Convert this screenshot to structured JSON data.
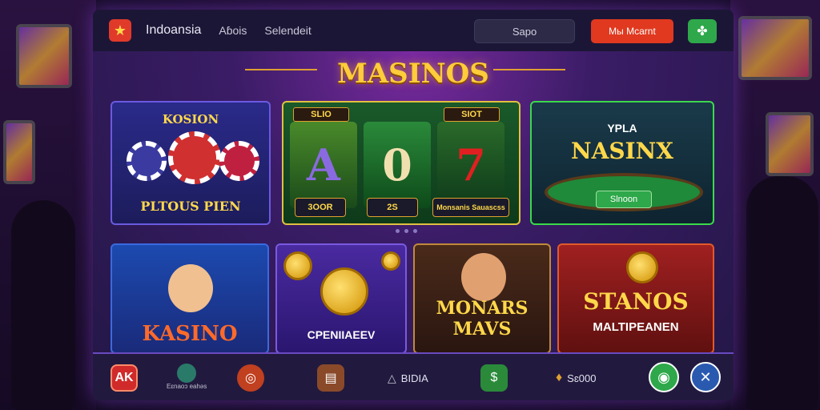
{
  "header": {
    "brand": "Indoansia",
    "nav": [
      "Aɓois",
      "Selendeit"
    ],
    "search_label": "Sapo",
    "cta_label": "Мы Mcarnt",
    "settings_icon": "clover-icon"
  },
  "section_title": "MASINOS",
  "cards_top": [
    {
      "top_label": "KOSION",
      "bottom_label": "PLTOUS PIEN"
    },
    {
      "reels": [
        {
          "tag": "SLIO",
          "symbol": "A",
          "bottom": "3OOR"
        },
        {
          "tag": "",
          "symbol": "0",
          "bottom": "2S"
        },
        {
          "tag": "SIOT",
          "symbol": "7",
          "bottom": "Monsanis Sauascss"
        }
      ]
    },
    {
      "top_label": "YPLA",
      "title": "NASINX",
      "button": "Slnoon"
    }
  ],
  "cards_bottom": [
    {
      "title": "KASINO"
    },
    {
      "title": "CPENIIAEEV"
    },
    {
      "title": "MONARS MAVS"
    },
    {
      "title": "STANOS",
      "subtitle": "MALTIPEANEN"
    }
  ],
  "dock": {
    "item1_icon": "ak-badge-icon",
    "item2_label": "Eɛnaoɔ eahəs",
    "item3_icon": "chip-icon",
    "item4_icon": "ticket-icon",
    "item5_label": "BIDIA",
    "item6_icon": "cash-icon",
    "item7_label": "Sɛ000",
    "item8_icon": "controller-icon",
    "item9_icon": "close-icon"
  },
  "colors": {
    "accent_gold": "#ffcc3a",
    "cta_red": "#e0391f",
    "accent_green": "#2ea84a",
    "bg_purple": "#2a1b4a"
  }
}
